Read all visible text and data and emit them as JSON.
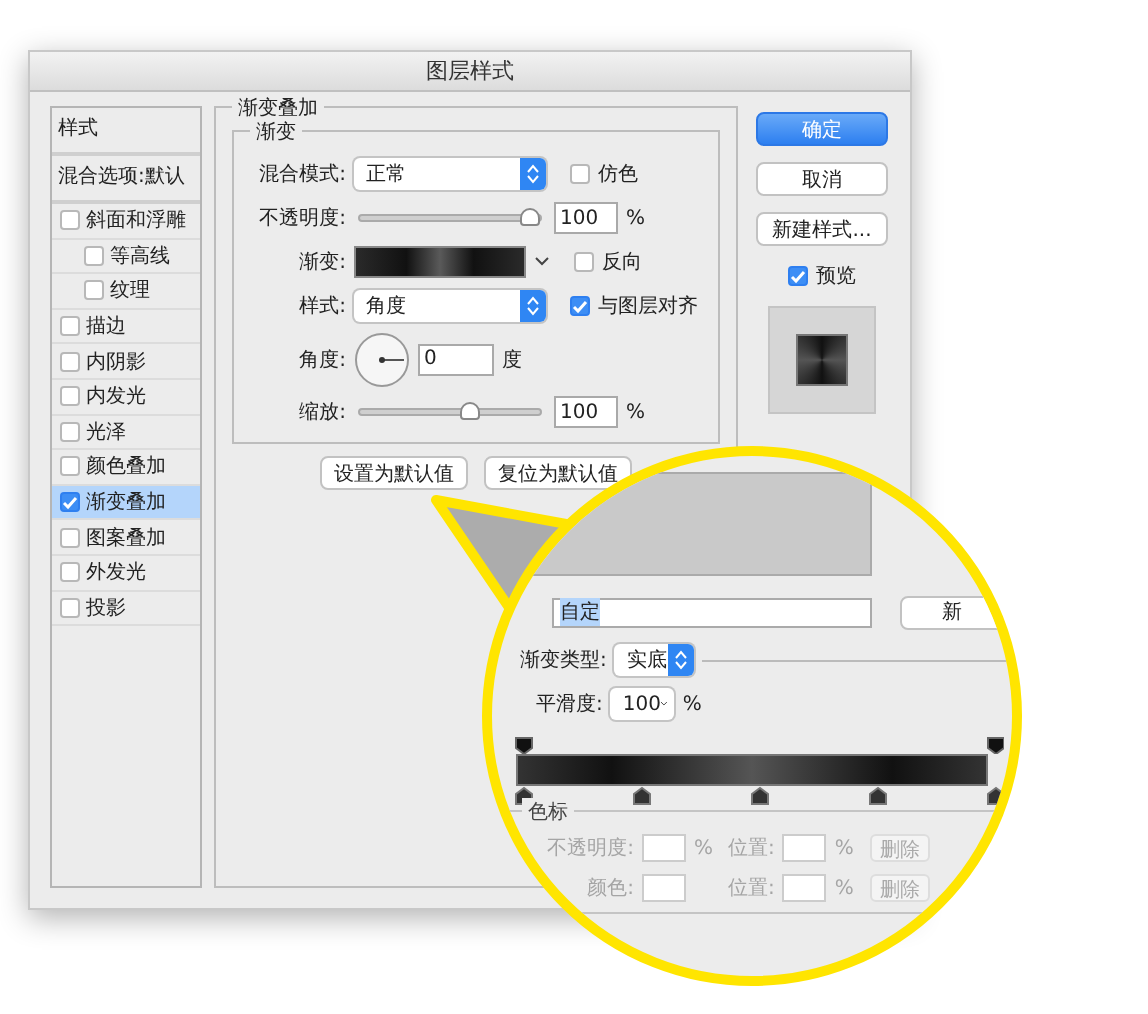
{
  "dialog": {
    "title": "图层样式"
  },
  "sidebar": {
    "header": "样式",
    "blend_options": "混合选项:默认",
    "items": [
      {
        "label": "斜面和浮雕",
        "checked": false,
        "selected": false,
        "children": [
          {
            "label": "等高线",
            "checked": false,
            "selected": false
          },
          {
            "label": "纹理",
            "checked": false,
            "selected": false
          }
        ]
      },
      {
        "label": "描边",
        "checked": false,
        "selected": false
      },
      {
        "label": "内阴影",
        "checked": false,
        "selected": false
      },
      {
        "label": "内发光",
        "checked": false,
        "selected": false
      },
      {
        "label": "光泽",
        "checked": false,
        "selected": false
      },
      {
        "label": "颜色叠加",
        "checked": false,
        "selected": false
      },
      {
        "label": "渐变叠加",
        "checked": true,
        "selected": true
      },
      {
        "label": "图案叠加",
        "checked": false,
        "selected": false
      },
      {
        "label": "外发光",
        "checked": false,
        "selected": false
      },
      {
        "label": "投影",
        "checked": false,
        "selected": false
      }
    ]
  },
  "panel": {
    "title": "渐变叠加",
    "group": "渐变",
    "blend_mode": {
      "label": "混合模式:",
      "value": "正常"
    },
    "dither": {
      "label": "仿色",
      "checked": false
    },
    "opacity": {
      "label": "不透明度:",
      "level": 1,
      "value": "100",
      "unit": "%"
    },
    "gradient": {
      "label": "渐变:"
    },
    "reverse": {
      "label": "反向",
      "checked": false
    },
    "style": {
      "label": "样式:",
      "value": "角度"
    },
    "align": {
      "label": "与图层对齐",
      "checked": true
    },
    "angle": {
      "label": "角度:",
      "value": "0",
      "unit": "度"
    },
    "scale": {
      "label": "缩放:",
      "level": 0.62,
      "value": "100",
      "unit": "%"
    },
    "buttons": [
      "设置为默认值",
      "复位为默认值"
    ]
  },
  "actions": {
    "buttons": [
      {
        "label": "确定",
        "kind": "primary"
      },
      {
        "label": "取消",
        "kind": "normal"
      },
      {
        "label": "新建样式...",
        "kind": "normal"
      }
    ],
    "preview": {
      "label": "预览",
      "checked": true
    }
  },
  "callout": {
    "name": {
      "value": "自定",
      "selected": true
    },
    "new_button": "新",
    "type": {
      "label": "渐变类型:",
      "value": "实底"
    },
    "smoothness": {
      "label": "平滑度:",
      "value": "100",
      "unit": "%"
    },
    "color_stops": {
      "title": "色标",
      "rows": [
        {
          "label": "不透明度:",
          "unit": "%",
          "position_label": "位置:",
          "position_unit": "%",
          "delete": "删除"
        },
        {
          "label": "颜色:",
          "unit": "",
          "position_label": "位置:",
          "position_unit": "%",
          "delete": "删除"
        }
      ]
    }
  }
}
